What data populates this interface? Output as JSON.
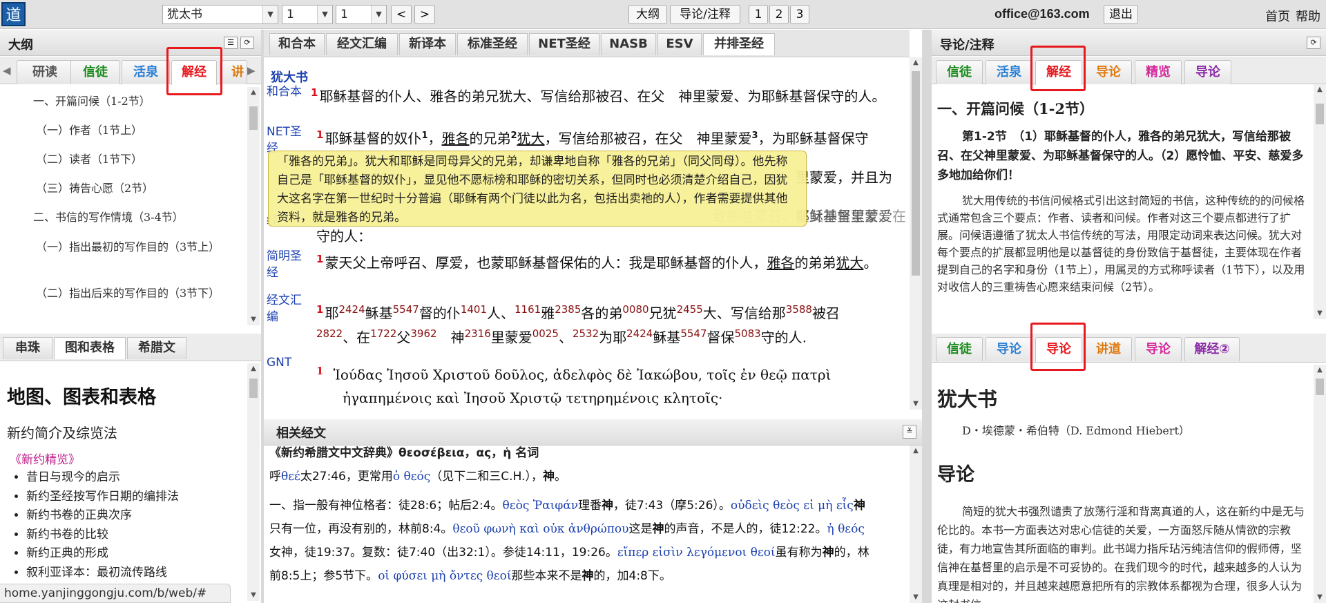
{
  "topbar": {
    "logo": "道",
    "book": "犹太书",
    "chapter": "1",
    "verse": "1",
    "prev": "<",
    "next": ">",
    "outline_btn": "大纲",
    "notes_btn": "导论/注释",
    "p1": "1",
    "p2": "2",
    "p3": "3",
    "email": "office@163.com",
    "logout": "退出",
    "home": "首页",
    "help": "帮助"
  },
  "left": {
    "title": "大纲",
    "tabs": [
      "研读",
      "信徒",
      "活泉",
      "解经",
      "讲"
    ],
    "toc": [
      "一、开篇问候（1-2节）",
      "（一）作者（1节上）",
      "（二）读者（1节下）",
      "（三）祷告心愿（2节）",
      "二、书信的写作情境（3-4节）",
      "（一）指出最初的写作目的（3节上）",
      "（二）指出后来的写作目的（3节下）"
    ],
    "tabs2": [
      "串珠",
      "图和表格",
      "希腊文"
    ],
    "maps_title": "地图、图表和表格",
    "nt_title": "新约简介及综览法",
    "nt_link": "《新约精览》",
    "items": [
      "昔日与现今的启示",
      "新约圣经按写作日期的编排法",
      "新约书卷的正典次序",
      "新约书卷的比较",
      "新约正典的形成",
      "叙利亚译本：最初流传路线"
    ],
    "url": "home.yanjinggongju.com/b/web/#"
  },
  "middle": {
    "tabs": [
      "和合本",
      "经文汇编",
      "新译本",
      "标准圣经",
      "NET圣经",
      "NASB",
      "ESV",
      "并排圣经"
    ],
    "book": "犹大书",
    "versions": [
      "和合本",
      "NET圣经",
      "新译本",
      "简明圣经",
      "经文汇编",
      "GNT",
      "NASB"
    ],
    "v_hh": "耶稣基督的仆人、雅各的弟兄犹大、写信给那被召、在父　神里蒙爱、为耶稣基督保守的人。",
    "v_net_a": "耶稣基督的奴仆",
    "v_net_sup1": "1",
    "v_net_b": "，",
    "v_net_c": "雅各",
    "v_net_d": "的兄弟",
    "v_net_sup2": "2",
    "v_net_e": "犹大",
    "v_net_f": "，写信给那被召，在父　神里蒙爱",
    "v_net_sup3": "3",
    "v_net_g": "，为耶稣基督保守",
    "v_new_tail": "里蒙爱，并且为",
    "v_new2": "守的人：",
    "v_new_faint": "致那些蒙召、在父神里蒙爱、在",
    "v_new_faint2": "耶稣基督里蒙爱",
    "v_jm_a": "蒙天父上帝呼召、厚爱，也蒙耶稣基督保佑的人：我是耶稣基督的仆人，",
    "v_jm_b": "雅各",
    "v_jm_c": "的弟弟",
    "v_jm_d": "犹大",
    "v_jm_e": "。",
    "v_hb": [
      [
        "耶",
        "2424"
      ],
      [
        "稣基",
        "5547"
      ],
      [
        "督的仆",
        "1401"
      ],
      [
        "人、",
        "1161"
      ],
      [
        "雅",
        "2385"
      ],
      [
        "各的弟",
        "0080"
      ],
      [
        "兄犹",
        "2455"
      ],
      [
        "大、写信给那",
        "3588"
      ],
      [
        "被召",
        ""
      ]
    ],
    "v_hb2": [
      [
        "",
        "2822"
      ],
      [
        "、在",
        "1722"
      ],
      [
        "父",
        "3962"
      ],
      [
        "　神",
        "2316"
      ],
      [
        "里蒙爱",
        "0025"
      ],
      [
        "、",
        "2532"
      ],
      [
        "为耶",
        "2424"
      ],
      [
        "稣基",
        "5547"
      ],
      [
        "督保",
        "5083"
      ],
      [
        "守的人.",
        ""
      ]
    ],
    "v_gnt1": "Ἰούδας Ἰησοῦ Χριστοῦ δοῦλος, ἀδελφὸς δὲ Ἰακώβου, τοῖς ἐν θεῷ πατρὶ",
    "v_gnt2": "ἠγαπημένοις καὶ Ἰησοῦ Χριστῷ τετηρημένοις κλητοῖς·",
    "tooltip": "「雅各的兄弟」。犹大和耶稣是同母异父的兄弟，却谦卑地自称「雅各的兄弟」（同父同母）。他先称自己是「耶稣基督的奴仆」，显见他不愿标榜和耶稣的密切关系，但同时也必须清楚介绍自己，因犹大这名字在第一世纪时十分普遍（耶稣有两个门徒以此为名，包括出卖祂的人），作者需要提供其他资料，就是雅各的兄弟。",
    "rel_title": "相关经文",
    "dict": "《新约希腊文中文辞典》θεοσέβεια，ας，ἡ 名词",
    "rel_lines": [
      [
        [
          "t",
          "呼"
        ],
        [
          "g",
          "θεέ"
        ],
        [
          "t",
          "太27:46，更常用"
        ],
        [
          "g",
          "ὁ θεός"
        ],
        [
          "t",
          "（见下二和三C.H.），"
        ],
        [
          "b",
          "神"
        ],
        [
          "t",
          "。"
        ]
      ],
      [
        [
          "t",
          "一、指一般有神位格者：徒28:6；帖后2:4。"
        ],
        [
          "g",
          "θεὸς Ῥαιφάν"
        ],
        [
          "t",
          "理番"
        ],
        [
          "b",
          "神"
        ],
        [
          "t",
          "，徒7:43（摩5:26）。"
        ],
        [
          "g",
          "οὐδεὶς θεὸς εἰ μὴ εἷς"
        ],
        [
          "b",
          "神"
        ]
      ],
      [
        [
          "t",
          "只有一位，再没有别的，林前8:4。"
        ],
        [
          "g",
          "θεοῦ φωνὴ καὶ οὐκ ἀνθρώπου"
        ],
        [
          "t",
          "这是"
        ],
        [
          "b",
          "神"
        ],
        [
          "t",
          "的声音，不是人的，徒12:22。"
        ],
        [
          "g",
          "ἡ θεός"
        ]
      ],
      [
        [
          "t",
          "女神，徒19:37。复数：徒7:40（出32:1）。参徒14:11，19:26。"
        ],
        [
          "g",
          "εἴπερ εἰσὶν λεγόμενοι θεοί"
        ],
        [
          "t",
          "虽有称为"
        ],
        [
          "b",
          "神"
        ],
        [
          "t",
          "的，林"
        ]
      ],
      [
        [
          "t",
          "前8:5上；参5节下。"
        ],
        [
          "g",
          "οἱ φύσει μὴ ὄντες θεοί"
        ],
        [
          "t",
          "那些本来不是"
        ],
        [
          "b",
          "神"
        ],
        [
          "t",
          "的，加4:8下。"
        ]
      ]
    ]
  },
  "right": {
    "title": "导论/注释",
    "tabs": [
      "信徒",
      "活泉",
      "解经",
      "导论",
      "精览",
      "导论"
    ],
    "tab_colors": [
      "#1a8a1a",
      "#2a7fd4",
      "#e8191e",
      "#e07a10",
      "#d42a9a",
      "#8a2aa8"
    ],
    "h1": "一、开篇问候（1-2节）",
    "bold": "第1-2节　（1）耶稣基督的仆人，雅各的弟兄犹大，写信给那被召、在父神里蒙爱、为耶稣基督保守的人。（2）愿怜恤、平安、慈爱多多地加给你们！",
    "para": "犹大用传统的书信问候格式引出这封简短的书信，这种传统的的问候格式通常包含三个要点：作者、读者和问候。作者对这三个要点都进行了扩展。问候语遵循了犹太人书信传统的写法，用限定动词来表达问候。犹大对每个要点的扩展都显明他是以基督徒的身份致信于基督徒，主要体现在作者提到自己的名字和身份（1节上），用属灵的方式称呼读者（1节下），以及用对收信人的三重祷告心愿来结束问候（2节）。",
    "tabs2": [
      "信徒",
      "导论",
      "导论",
      "讲道",
      "导论",
      "解经②"
    ],
    "tab2_colors": [
      "#1a8a1a",
      "#2a7fd4",
      "#e8191e",
      "#e07a10",
      "#d42a9a",
      "#8a2aa8"
    ],
    "book": "犹大书",
    "author": "D・埃德蒙・希伯特（D. Edmond Hiebert）",
    "intro": "导论",
    "intro_para": "简短的犹大书强烈谴责了放荡行淫和背离真道的人，这在新约中是无与伦比的。本书一方面表达对忠心信徒的关爱，一方面怒斥随从情欲的宗教徒，有力地宣告其所面临的审判。此书竭力指斥玷污纯洁信仰的假师傅，坚信神在基督里的启示是不可妥协的。在我们现今的时代，越来越多的人认为真理是相对的，并且越来越愿意把所有的宗教体系都视为合理，很多人认为这封书信"
  }
}
